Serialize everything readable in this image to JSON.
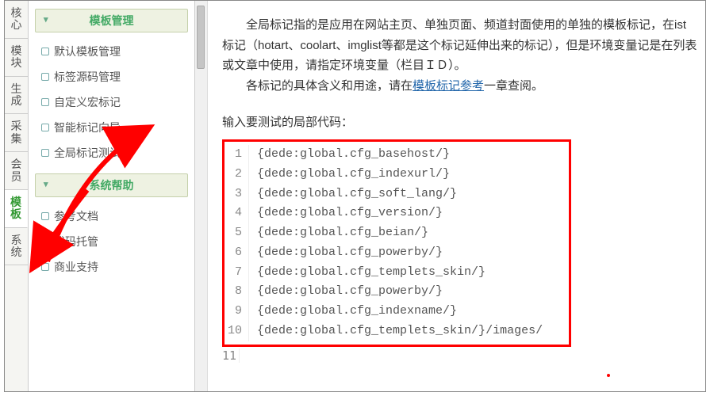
{
  "vtabs": [
    "核心",
    "模块",
    "生成",
    "采集",
    "会员",
    "模板",
    "系统"
  ],
  "active_vtab_index": 5,
  "sidebar": {
    "groups": [
      {
        "title": "模板管理",
        "items": [
          "默认模板管理",
          "标签源码管理",
          "自定义宏标记",
          "智能标记向导",
          "全局标记测试"
        ]
      },
      {
        "title": "系统帮助",
        "items": [
          "参考文档",
          "代码托管",
          "商业支持"
        ]
      }
    ]
  },
  "content": {
    "para1": "全局标记指的是应用在网站主页、单独页面、频道封面使用的单独的模板标记，在ist标记（hotart、coolart、imglist等都是这个标记延伸出来的标记），但是环境变量记是在列表或文章中使用，请指定环境变量（栏目ＩＤ）。",
    "para2_prefix": "各标记的具体含义和用途，请在",
    "para2_link": "模板标记参考",
    "para2_suffix": "一章查阅。",
    "prompt": "输入要测试的局部代码：",
    "code_lines": [
      "{dede:global.cfg_basehost/}",
      "{dede:global.cfg_indexurl/}",
      "{dede:global.cfg_soft_lang/}",
      "{dede:global.cfg_version/}",
      "{dede:global.cfg_beian/}",
      "{dede:global.cfg_powerby/}",
      "{dede:global.cfg_templets_skin/}",
      "{dede:global.cfg_powerby/}",
      "{dede:global.cfg_indexname/}",
      "{dede:global.cfg_templets_skin/}/images/"
    ],
    "extra_line_num": "11"
  },
  "annotation": {
    "arrow_color": "#ff0000"
  }
}
